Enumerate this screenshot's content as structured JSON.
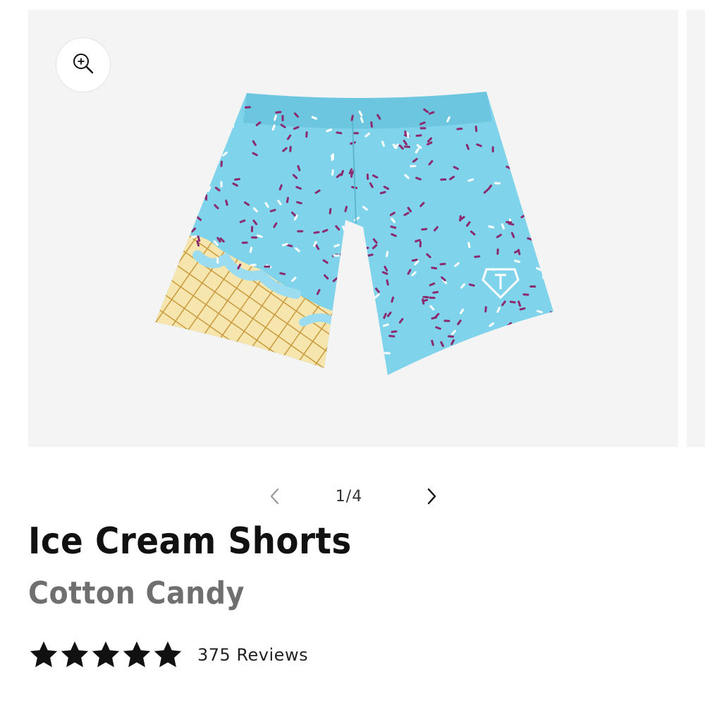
{
  "gallery": {
    "zoom_icon": "zoom-in-icon",
    "image_alt": "Ice Cream Shorts - Cotton Candy",
    "colors": {
      "background": "#f4f4f4",
      "shorts_blue": "#7fd3ea",
      "sprinkle_purple": "#8b2a6e",
      "sprinkle_white": "#ffffff",
      "cone_yellow": "#f3dfa0",
      "cone_grid": "#c99a3e"
    }
  },
  "pager": {
    "prev_icon": "chevron-left-icon",
    "next_icon": "chevron-right-icon",
    "count": "1/4"
  },
  "product": {
    "title": "Ice Cream Shorts",
    "color_name": "Cotton Candy"
  },
  "rating": {
    "stars": 5,
    "max_stars": 5,
    "reviews_label": "375 Reviews"
  }
}
